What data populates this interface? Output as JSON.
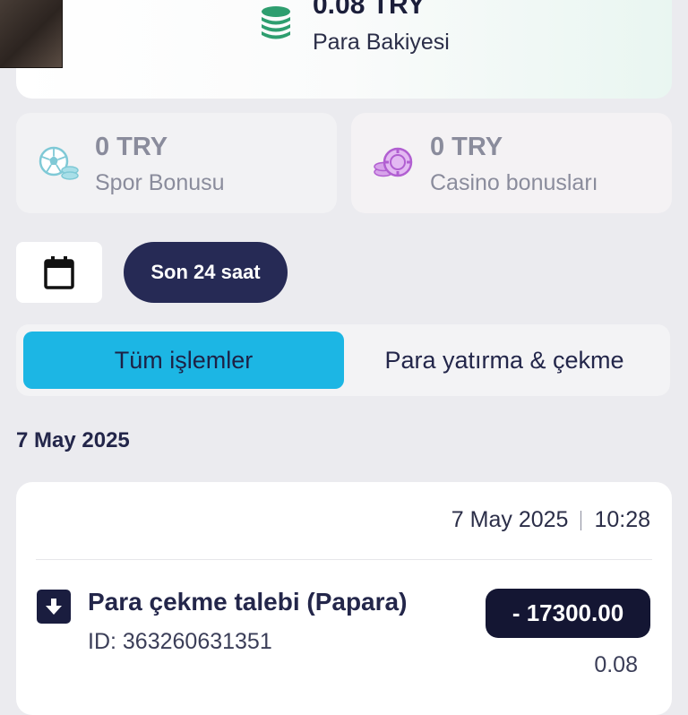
{
  "balance": {
    "amount": "0.08 TRY",
    "label": "Para Bakiyesi",
    "icon": "coins-stack-icon",
    "accent": "#2e9e6f"
  },
  "bonuses": [
    {
      "amount": "0 TRY",
      "label": "Spor Bonusu",
      "icon": "soccer-ball-coins-icon",
      "accent": "#7fc9d6"
    },
    {
      "amount": "0 TRY",
      "label": "Casino bonusları",
      "icon": "casino-chips-icon",
      "accent": "#b15fd1"
    }
  ],
  "filters": {
    "calendar_icon": "calendar-icon",
    "range_label": "Son 24 saat"
  },
  "tabs": [
    {
      "label": "Tüm işlemler",
      "active": true
    },
    {
      "label": "Para yatırma & çekme",
      "active": false
    }
  ],
  "section_date": "7 May 2025",
  "transaction": {
    "date": "7 May 2025",
    "time": "10:28",
    "title": "Para çekme talebi (Papara)",
    "id": "ID: 363260631351",
    "amount": "- 17300.00",
    "balance_after": "0.08",
    "icon": "download-arrow-icon"
  },
  "colors": {
    "background": "#ebebef",
    "primary_dark": "#262a55",
    "tab_active": "#1cb6e4",
    "text": "#23264a"
  }
}
